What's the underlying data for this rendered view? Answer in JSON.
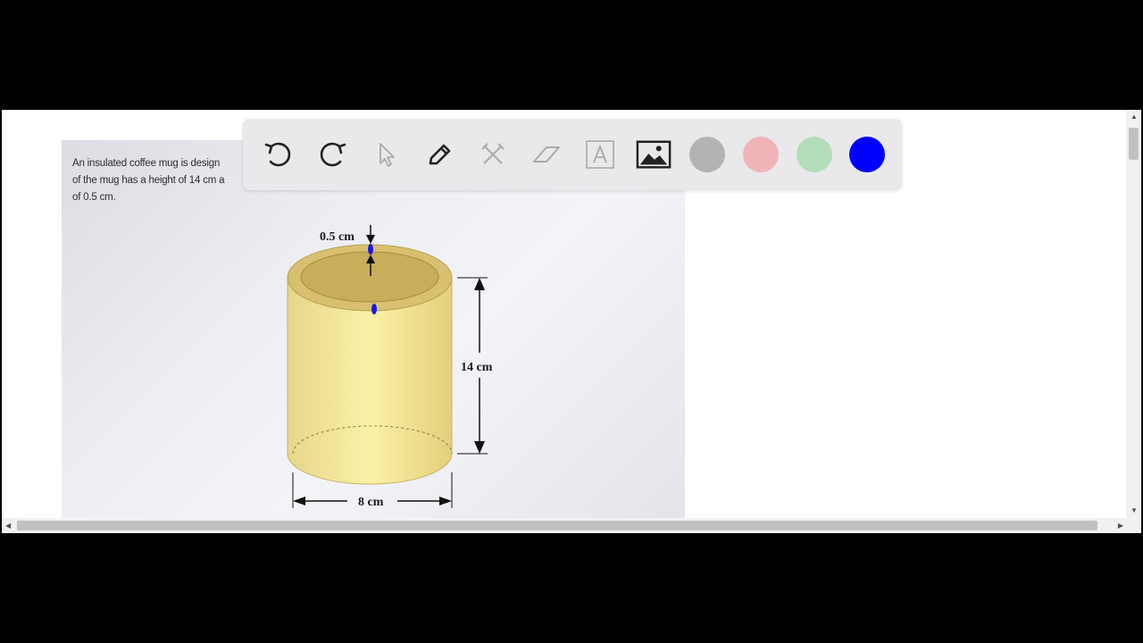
{
  "problem": {
    "line1": "An insulated coffee mug is design",
    "line2": "of the mug has a height of 14 cm a",
    "line3": "of 0.5 cm."
  },
  "figure": {
    "wall_thickness_label": "0.5 cm",
    "height_label": "14 cm",
    "diameter_label": "8 cm"
  },
  "toolbar": {
    "tools": [
      "undo-icon",
      "redo-icon",
      "pointer-icon",
      "pen-icon",
      "tools-icon",
      "eraser-icon",
      "text-icon",
      "image-icon"
    ],
    "swatches": [
      "#b3b3b3",
      "#f0b4b8",
      "#b3dcb8",
      "#0000ff"
    ]
  },
  "scrollbars": {
    "up": "▲",
    "down": "▼",
    "left": "◀",
    "right": "▶"
  }
}
